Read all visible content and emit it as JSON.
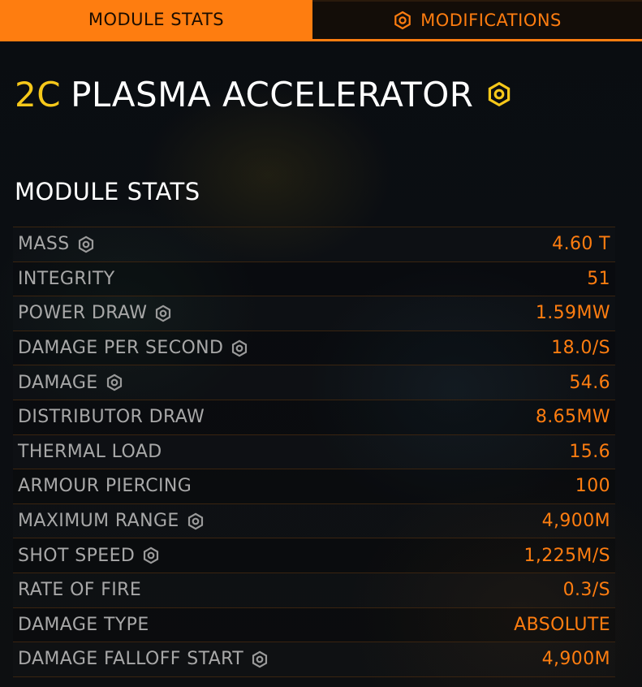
{
  "tabs": {
    "module_stats": "MODULE STATS",
    "modifications": "MODIFICATIONS",
    "modifications_icon": "engineering-hex-icon"
  },
  "module": {
    "grade": "2C",
    "name": "PLASMA ACCELERATOR",
    "engineered_icon": "engineering-hex-icon"
  },
  "section_heading": "MODULE STATS",
  "stats": [
    {
      "label": "MASS",
      "value": "4.60 T",
      "modified": true
    },
    {
      "label": "INTEGRITY",
      "value": "51",
      "modified": false
    },
    {
      "label": "POWER DRAW",
      "value": "1.59MW",
      "modified": true
    },
    {
      "label": "DAMAGE PER SECOND",
      "value": "18.0/S",
      "modified": true
    },
    {
      "label": "DAMAGE",
      "value": "54.6",
      "modified": true
    },
    {
      "label": "DISTRIBUTOR DRAW",
      "value": "8.65MW",
      "modified": false
    },
    {
      "label": "THERMAL LOAD",
      "value": "15.6",
      "modified": false
    },
    {
      "label": "ARMOUR PIERCING",
      "value": "100",
      "modified": false
    },
    {
      "label": "MAXIMUM RANGE",
      "value": "4,900M",
      "modified": true
    },
    {
      "label": "SHOT SPEED",
      "value": "1,225M/S",
      "modified": true
    },
    {
      "label": "RATE OF FIRE",
      "value": "0.3/S",
      "modified": false
    },
    {
      "label": "DAMAGE TYPE",
      "value": "ABSOLUTE",
      "modified": false
    },
    {
      "label": "DAMAGE FALLOFF START",
      "value": "4,900M",
      "modified": true
    }
  ],
  "colors": {
    "accent": "#fe7d10",
    "grade": "#f6c81a",
    "label": "#a8a8a8",
    "title": "#ffffff"
  }
}
